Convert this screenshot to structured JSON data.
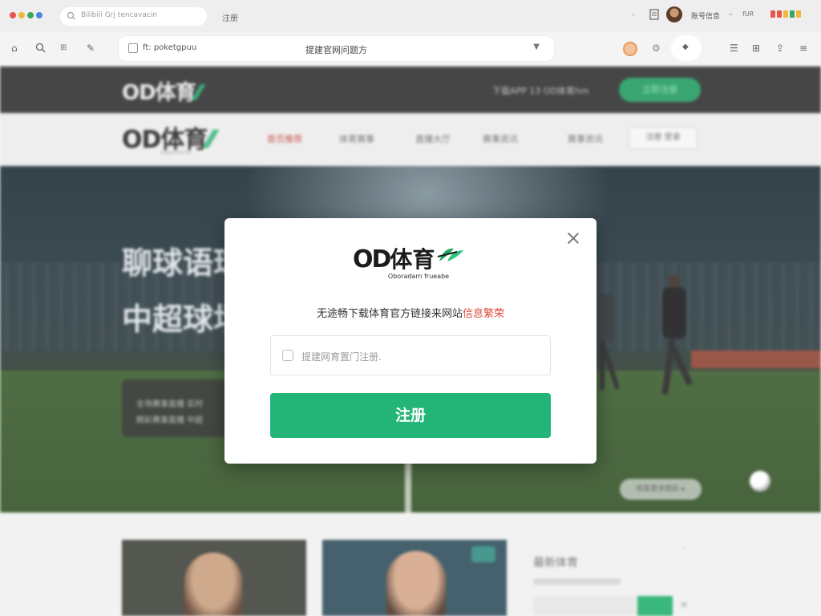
{
  "browser": {
    "tab_title": "Bilibili Grj tencavacin",
    "tab2_label": "注册",
    "account_name": "账号信息",
    "account_extra": "fUR",
    "url_left": "ft: poketgpuu",
    "url_center": "提建官网问题方",
    "colors": {
      "dot1": "#e8554b",
      "dot2": "#f2b63d",
      "dot3": "#3aa85c",
      "dot4": "#4b86e0"
    }
  },
  "site": {
    "logo_od": "OD",
    "logo_cn": "体育",
    "top_info": "下载APP   13   OD体育hm",
    "top_button": "立即注册",
    "nav_logo_sub": "Odsportsinfo",
    "nav": [
      "首页推荐",
      "体育赛事",
      "直播大厅",
      "赛事资讯",
      "赛事资讯"
    ],
    "nav_button": "注册 登录",
    "hero_line1": "聊球语球",
    "hero_line2": "中超球场",
    "hero_card_line1": "全场赛事直播 实时",
    "hero_card_line2": "精彩赛事直播 中超",
    "hero_pill": "观看更多精彩 ▸",
    "side_title": "最新体育"
  },
  "modal": {
    "logo_od": "OD",
    "logo_cn": "体育",
    "subtitle": "Oboradarn frueabe",
    "desc_main": "无途畅下载体育官方链接来网站",
    "desc_highlight": "信息繁荣",
    "input_placeholder": "提建网育置门注册.",
    "submit_label": "注册",
    "brand_green": "#23b477",
    "highlight_red": "#e0463c"
  }
}
